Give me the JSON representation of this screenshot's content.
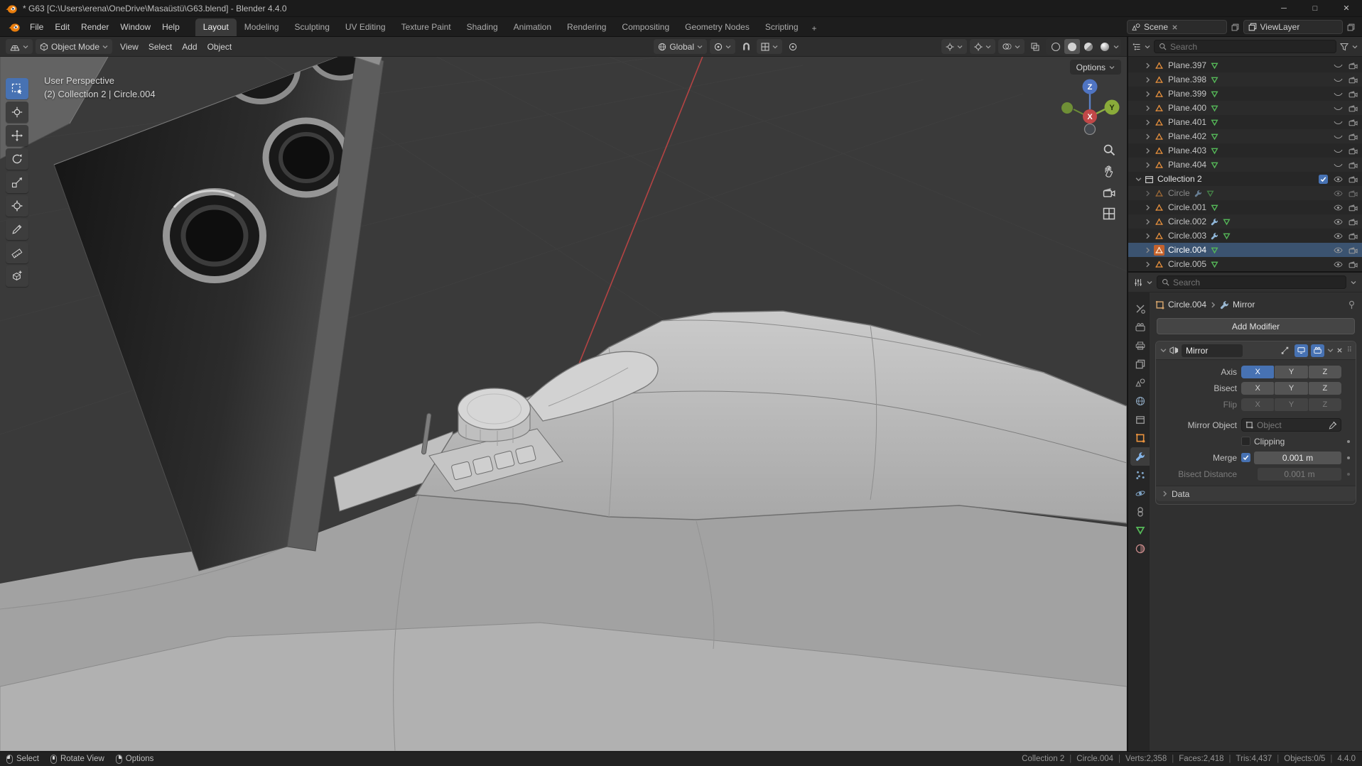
{
  "colors": {
    "accent_blue": "#4772b3",
    "object_orange": "#e8913d",
    "mesh_data_green": "#55b858",
    "axis_x_red": "#c14848",
    "axis_y_green": "#8aab3a",
    "axis_z_blue": "#4f74c2"
  },
  "window": {
    "title": "* G63 [C:\\Users\\erena\\OneDrive\\Masaüstü\\G63.blend] - Blender 4.4.0",
    "controls": {
      "minimize": "─",
      "maximize": "□",
      "close": "✕"
    }
  },
  "menubar": {
    "menus": [
      "File",
      "Edit",
      "Render",
      "Window",
      "Help"
    ],
    "workspaces": [
      "Layout",
      "Modeling",
      "Sculpting",
      "UV Editing",
      "Texture Paint",
      "Shading",
      "Animation",
      "Rendering",
      "Compositing",
      "Geometry Nodes",
      "Scripting"
    ],
    "active_workspace": "Layout",
    "add_workspace": "+",
    "scene": {
      "label": "Scene"
    },
    "view_layer": {
      "label": "ViewLayer"
    }
  },
  "viewport": {
    "header": {
      "mode": "Object Mode",
      "menus": [
        "View",
        "Select",
        "Add",
        "Object"
      ],
      "orientation": "Global"
    },
    "options_button": "Options",
    "overlay": {
      "line1": "User Perspective",
      "line2": "(2) Collection 2 | Circle.004"
    },
    "gizmo": {
      "x": "X",
      "y": "Y",
      "z": "Z"
    },
    "nav_icons": [
      {
        "id": "zoom",
        "icon": "search"
      },
      {
        "id": "pan",
        "icon": "hand"
      },
      {
        "id": "camera-view",
        "icon": "cam"
      },
      {
        "id": "toggle-orthographic",
        "icon": "grid4"
      }
    ]
  },
  "toolbar": {
    "tools": [
      {
        "id": "select-box",
        "icon": "selbox",
        "active": true
      },
      {
        "id": "cursor",
        "icon": "cursor3d"
      },
      {
        "id": "move",
        "icon": "move"
      },
      {
        "id": "rotate",
        "icon": "rotate"
      },
      {
        "id": "scale",
        "icon": "scale"
      },
      {
        "id": "transform",
        "icon": "transform"
      },
      {
        "id": "annotate",
        "icon": "pen"
      },
      {
        "id": "measure",
        "icon": "ruler"
      },
      {
        "id": "add-cube",
        "icon": "addcube"
      }
    ]
  },
  "outliner": {
    "search_placeholder": "Search",
    "items": [
      {
        "label": "Plane.397",
        "kind": "mesh",
        "indent": 1,
        "data": true,
        "eye": "closed"
      },
      {
        "label": "Plane.398",
        "kind": "mesh",
        "indent": 1,
        "data": true,
        "eye": "closed"
      },
      {
        "label": "Plane.399",
        "kind": "mesh",
        "indent": 1,
        "data": true,
        "eye": "closed"
      },
      {
        "label": "Plane.400",
        "kind": "mesh",
        "indent": 1,
        "data": true,
        "eye": "closed"
      },
      {
        "label": "Plane.401",
        "kind": "mesh",
        "indent": 1,
        "data": true,
        "eye": "closed"
      },
      {
        "label": "Plane.402",
        "kind": "mesh",
        "indent": 1,
        "data": true,
        "eye": "closed"
      },
      {
        "label": "Plane.403",
        "kind": "mesh",
        "indent": 1,
        "data": true,
        "eye": "closed"
      },
      {
        "label": "Plane.404",
        "kind": "mesh",
        "indent": 1,
        "data": true,
        "eye": "closed"
      },
      {
        "label": "Collection 2",
        "kind": "collection",
        "indent": 0,
        "expanded": true,
        "checkbox": true,
        "eye": "open"
      },
      {
        "label": "Circle",
        "kind": "mesh",
        "indent": 1,
        "dim": true,
        "modifier": true,
        "data": true,
        "eye": "open"
      },
      {
        "label": "Circle.001",
        "kind": "mesh",
        "indent": 1,
        "data": true,
        "eye": "open"
      },
      {
        "label": "Circle.002",
        "kind": "mesh",
        "indent": 1,
        "modifier": true,
        "data": true,
        "eye": "open"
      },
      {
        "label": "Circle.003",
        "kind": "mesh",
        "indent": 1,
        "modifier": true,
        "data": true,
        "eye": "open"
      },
      {
        "label": "Circle.004",
        "kind": "mesh",
        "indent": 1,
        "selected": true,
        "data": true,
        "eye": "open"
      },
      {
        "label": "Circle.005",
        "kind": "mesh",
        "indent": 1,
        "data": true,
        "eye": "open"
      }
    ]
  },
  "properties": {
    "search_placeholder": "Search",
    "tabs": [
      {
        "id": "tool",
        "icon": "tooltab"
      },
      {
        "id": "render",
        "icon": "camback"
      },
      {
        "id": "output",
        "icon": "printer"
      },
      {
        "id": "view-layer",
        "icon": "layers"
      },
      {
        "id": "scene",
        "icon": "scene"
      },
      {
        "id": "world",
        "icon": "globe"
      },
      {
        "id": "collection",
        "icon": "coll"
      },
      {
        "id": "object",
        "icon": "objsq"
      },
      {
        "id": "modifiers",
        "icon": "wrench"
      },
      {
        "id": "particles",
        "icon": "particles"
      },
      {
        "id": "physics",
        "icon": "physics"
      },
      {
        "id": "constraints",
        "icon": "constraint"
      },
      {
        "id": "data",
        "icon": "tri-down"
      },
      {
        "id": "material",
        "icon": "material"
      }
    ],
    "active_tab": "modifiers",
    "breadcrumb": {
      "object": "Circle.004",
      "modifier": "Mirror"
    },
    "add_modifier_label": "Add Modifier",
    "modifier": {
      "name": "Mirror",
      "axis_label": "Axis",
      "bisect_label": "Bisect",
      "flip_label": "Flip",
      "axis_options": [
        "X",
        "Y",
        "Z"
      ],
      "axis_active": "X",
      "mirror_object_label": "Mirror Object",
      "mirror_object_placeholder": "Object",
      "clipping_label": "Clipping",
      "clipping_checked": false,
      "merge_label": "Merge",
      "merge_checked": true,
      "merge_value": "0.001 m",
      "bisect_distance_label": "Bisect Distance",
      "bisect_distance_value": "0.001 m",
      "data_section_label": "Data"
    }
  },
  "statusbar": {
    "hints": [
      {
        "button": "left",
        "label": "Select"
      },
      {
        "button": "middle",
        "label": "Rotate View"
      },
      {
        "button": "right",
        "label": "Options"
      }
    ],
    "stats": [
      "Collection 2",
      "Circle.004",
      "Verts:2,358",
      "Faces:2,418",
      "Tris:4,437",
      "Objects:0/5",
      "4.4.0"
    ]
  }
}
